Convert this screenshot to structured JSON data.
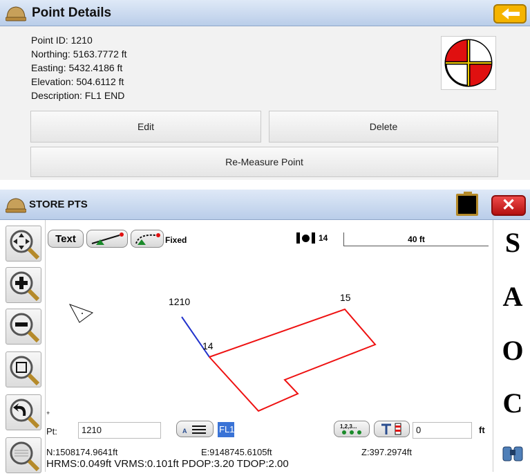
{
  "point_details": {
    "title": "Point Details",
    "point_id": "Point ID: 1210",
    "northing": "Northing: 5163.7772 ft",
    "easting": "Easting: 5432.4186 ft",
    "elevation": "Elevation: 504.6112 ft",
    "description": "Description: FL1 END",
    "edit_label": "Edit",
    "delete_label": "Delete",
    "remeasure_label": "Re-Measure Point"
  },
  "store_pts": {
    "title": "STORE PTS",
    "text_btn": "Text",
    "fixed_label": "Fixed",
    "count": "14",
    "scale": "40 ft",
    "side_letters": [
      "S",
      "A",
      "O",
      "C"
    ],
    "map_labels": {
      "p1210": "1210",
      "p15": "15",
      "p14": "14"
    },
    "pt_label": "Pt:",
    "pt_value": "1210",
    "desc_value": "FL1",
    "height_value": "0",
    "height_unit": "ft",
    "n": "N:1508174.9641ft",
    "e": "E:9148745.6105ft",
    "z": "Z:397.2974ft",
    "rms": "HRMS:0.049ft VRMS:0.101ft PDOP:3.20 TDOP:2.00"
  },
  "colors": {
    "line_red": "#ee1111",
    "line_blue": "#2233cc",
    "back_btn": "#f5b400",
    "close_btn": "#d61d1d"
  }
}
